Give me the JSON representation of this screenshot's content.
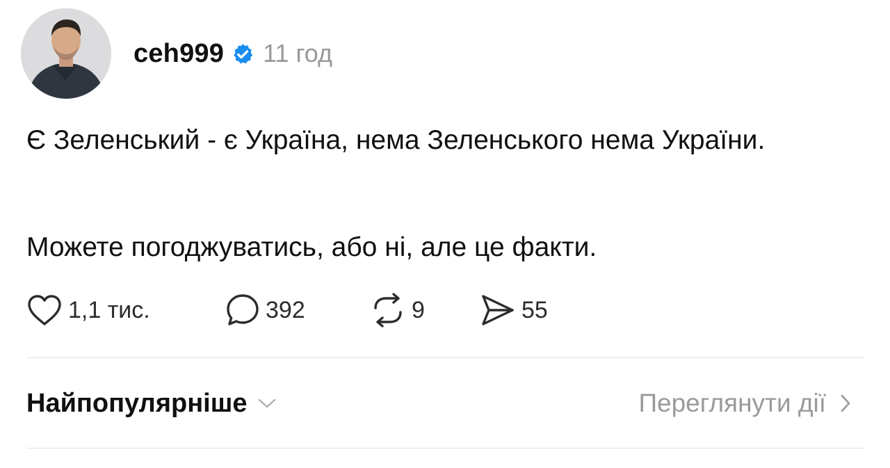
{
  "post": {
    "author": {
      "username": "ceh999",
      "verified": true,
      "verified_color": "#1a8cf0"
    },
    "timestamp": "11 год",
    "paragraphs": [
      "Є Зеленський - є Україна, нема Зеленського нема України.",
      "Можете погоджуватись, або ні, але це факти."
    ],
    "actions": {
      "like": {
        "icon": "heart-icon",
        "count": "1,1 тис."
      },
      "comment": {
        "icon": "speech-bubble-icon",
        "count": "392"
      },
      "repost": {
        "icon": "repost-arrows-icon",
        "count": "9"
      },
      "share": {
        "icon": "paper-plane-icon",
        "count": "55"
      }
    }
  },
  "replies_bar": {
    "sort_label": "Найпопулярніше",
    "sort_icon": "chevron-down-icon",
    "view_activity_label": "Переглянути дії",
    "view_activity_icon": "chevron-right-icon"
  },
  "colors": {
    "text_primary": "#101010",
    "text_secondary": "#999999",
    "divider": "#e2e2e2"
  }
}
